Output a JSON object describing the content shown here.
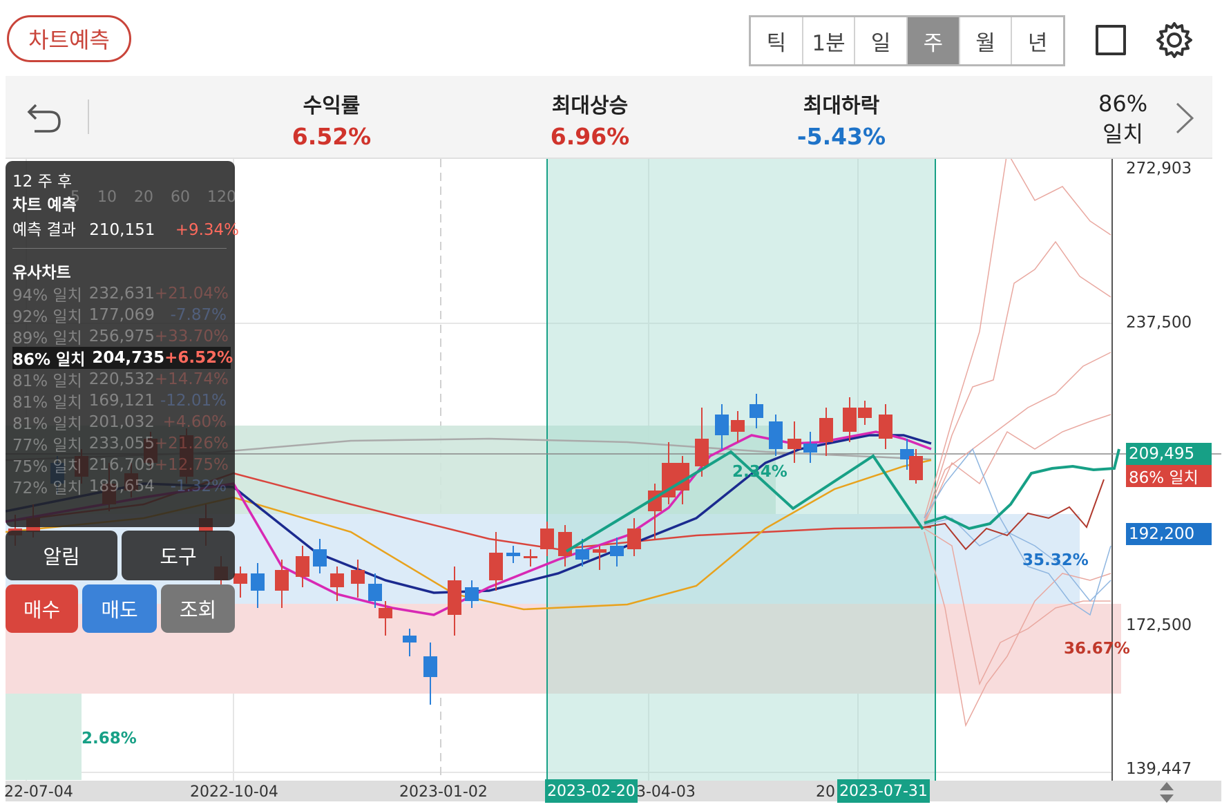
{
  "header": {
    "predict_button": "차트예측",
    "periods": [
      "틱",
      "1분",
      "일",
      "주",
      "월",
      "년"
    ],
    "active_period": "주"
  },
  "stats": {
    "return_label": "수익률",
    "return_value": "6.52%",
    "max_rise_label": "최대상승",
    "max_rise_value": "6.96%",
    "max_fall_label": "최대하락",
    "max_fall_value": "-5.43%",
    "match_pct": "86%",
    "match_label": "일치"
  },
  "overlay": {
    "weeks_after": "12 주 후",
    "predict_title": "차트 예측",
    "predict_result_label": "예측 결과",
    "predict_result_value": "210,151",
    "predict_result_pct": "+9.34%",
    "similar_title": "유사차트",
    "similar": [
      {
        "match": "94% 일치",
        "price": "232,631",
        "pct": "+21.04%",
        "dir": "r"
      },
      {
        "match": "92% 일치",
        "price": "177,069",
        "pct": "-7.87%",
        "dir": "b"
      },
      {
        "match": "89% 일치",
        "price": "256,975",
        "pct": "+33.70%",
        "dir": "r"
      },
      {
        "match": "86% 일치",
        "price": "204,735",
        "pct": "+6.52%",
        "dir": "r",
        "selected": true
      },
      {
        "match": "81% 일치",
        "price": "220,532",
        "pct": "+14.74%",
        "dir": "r"
      },
      {
        "match": "81% 일치",
        "price": "169,121",
        "pct": "-12.01%",
        "dir": "b"
      },
      {
        "match": "81% 일치",
        "price": "201,032",
        "pct": "+4.60%",
        "dir": "r"
      },
      {
        "match": "77% 일치",
        "price": "233,055",
        "pct": "+21.26%",
        "dir": "r"
      },
      {
        "match": "75% 일치",
        "price": "216,709",
        "pct": "+12.75%",
        "dir": "r"
      },
      {
        "match": "72% 일치",
        "price": "189,654",
        "pct": "-1.32%",
        "dir": "b"
      }
    ],
    "ma_legend": [
      "5",
      "10",
      "20",
      "60",
      "120"
    ]
  },
  "buttons": {
    "alarm": "알림",
    "tool": "도구",
    "buy": "매수",
    "sell": "매도",
    "inquiry": "조회"
  },
  "chart": {
    "y_ticks": [
      "272,903",
      "237,500",
      "172,500",
      "139,447"
    ],
    "x_ticks": [
      "22-07-04",
      "2022-10-04",
      "2023-01-02",
      "3-04-03",
      "20"
    ],
    "range_start_tag": "2023-02-20",
    "range_end_tag": "2023-07-31",
    "current_price_tag": "209,495",
    "match_tag": "86% 일치",
    "last_price_tag": "192,200",
    "pct_labels": {
      "left_bottom": "2.68%",
      "blue_zone": "35.32%",
      "red_zone": "36.67%",
      "mid": "2.34%"
    },
    "colors": {
      "up": "#d9453d",
      "down": "#2a7fd8",
      "accent_green": "#17a086",
      "ma5": "#d829b4",
      "ma10": "#1b2a8f",
      "ma20": "#e8a21d",
      "ma60": "#d9453d",
      "ma120": "#aaaaaa"
    }
  },
  "chart_data": {
    "type": "candlestick",
    "x_labels": [
      "22-07-04",
      "2022-10-04",
      "2023-01-02",
      "3-04-03",
      "2023-07-31"
    ],
    "ylim": [
      139447,
      272903
    ],
    "highlight_range": [
      "2023-02-20",
      "2023-07-31"
    ],
    "last_price": 192200,
    "forecast_price": 209495,
    "series": [
      {
        "name": "5",
        "color": "#d829b4"
      },
      {
        "name": "10",
        "color": "#1b2a8f"
      },
      {
        "name": "20",
        "color": "#e8a21d"
      },
      {
        "name": "60",
        "color": "#d9453d"
      },
      {
        "name": "120",
        "color": "#aaaaaa"
      }
    ]
  }
}
